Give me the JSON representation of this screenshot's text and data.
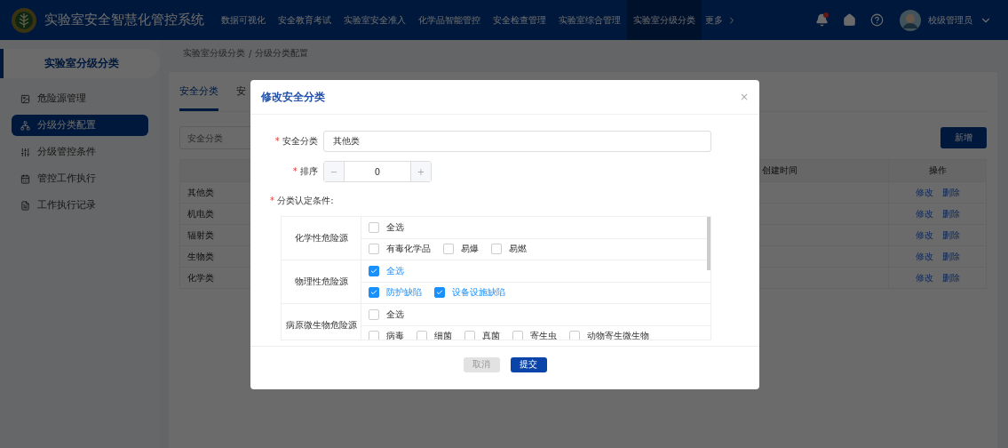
{
  "header": {
    "title": "实验室安全智慧化管控系统",
    "nav": [
      {
        "label": "数据可视化",
        "selected": false
      },
      {
        "label": "安全教育考试",
        "selected": false
      },
      {
        "label": "实验室安全准入",
        "selected": false
      },
      {
        "label": "化学品智能管控",
        "selected": false
      },
      {
        "label": "安全检查管理",
        "selected": false
      },
      {
        "label": "实验室综合管理",
        "selected": false
      },
      {
        "label": "实验室分级分类",
        "selected": true
      }
    ],
    "more": "更多",
    "notification": true,
    "user": "校级管理员"
  },
  "sidebar": {
    "title": "实验室分级分类",
    "items": [
      {
        "label": "危险源管理",
        "selected": false
      },
      {
        "label": "分级分类配置",
        "selected": true
      },
      {
        "label": "分级管控条件",
        "selected": false
      },
      {
        "label": "管控工作执行",
        "selected": false
      },
      {
        "label": "工作执行记录",
        "selected": false
      }
    ]
  },
  "breadcrumb": {
    "items": [
      "实验室分级分类",
      "分级分类配置"
    ],
    "separator": "/"
  },
  "tabs": [
    {
      "label": "安全分类",
      "selected": true
    },
    {
      "label": "安",
      "selected": false
    }
  ],
  "search": {
    "placeholder": "安全分类"
  },
  "add_button": "新增",
  "table": {
    "columns": [
      "创建时间",
      "操作"
    ],
    "rows": [
      {
        "name": "其他类",
        "actions": [
          "修改",
          "删除"
        ]
      },
      {
        "name": "机电类",
        "actions": [
          "修改",
          "删除"
        ]
      },
      {
        "name": "辐射类",
        "actions": [
          "修改",
          "删除"
        ]
      },
      {
        "name": "生物类",
        "actions": [
          "修改",
          "删除"
        ]
      },
      {
        "name": "化学类",
        "actions": [
          "修改",
          "删除"
        ]
      }
    ]
  },
  "modal": {
    "title": "修改安全分类",
    "close": "×",
    "name_field": {
      "label": "安全分类",
      "value": "其他类",
      "required_mark": "*"
    },
    "order_field": {
      "label": "排序",
      "value": "0",
      "minus": "−",
      "plus": "+",
      "required_mark": "*"
    },
    "conditions_label": {
      "label": "分类认定条件:",
      "required_mark": "*"
    },
    "conditions": [
      {
        "category": "化学性危险源",
        "select_all": {
          "label": "全选",
          "checked": false
        },
        "options": [
          {
            "label": "有毒化学品",
            "checked": false
          },
          {
            "label": "易爆",
            "checked": false
          },
          {
            "label": "易燃",
            "checked": false
          }
        ]
      },
      {
        "category": "物理性危险源",
        "select_all": {
          "label": "全选",
          "checked": true
        },
        "options": [
          {
            "label": "防护缺陷",
            "checked": true
          },
          {
            "label": "设备设施缺陷",
            "checked": true
          }
        ]
      },
      {
        "category": "病原微生物危险源",
        "select_all": {
          "label": "全选",
          "checked": false
        },
        "options": [
          {
            "label": "病毒",
            "checked": false
          },
          {
            "label": "细菌",
            "checked": false
          },
          {
            "label": "真菌",
            "checked": false
          },
          {
            "label": "寄生虫",
            "checked": false
          },
          {
            "label": "动物寄生微生物",
            "checked": false
          }
        ]
      }
    ],
    "cancel": {
      "label": "取消",
      "disabled": true
    },
    "submit": {
      "label": "提交",
      "disabled": false
    }
  }
}
